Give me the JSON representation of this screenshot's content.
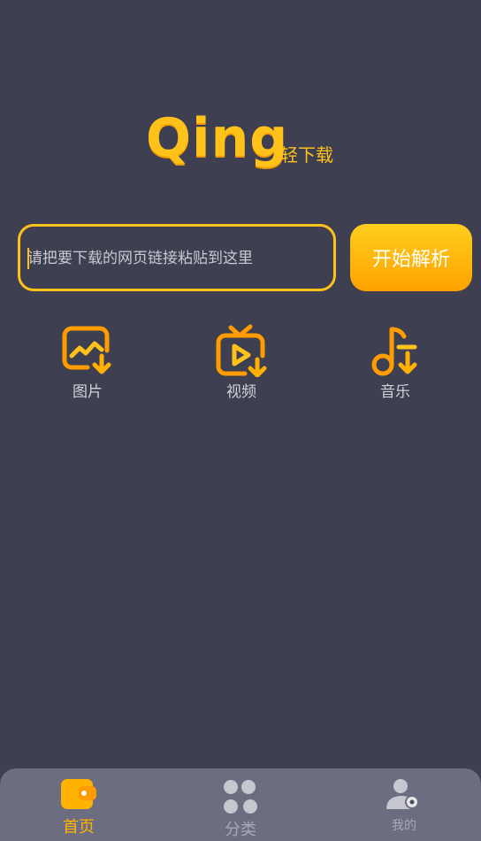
{
  "logo": {
    "word": "Qing",
    "subtitle": "轻下载"
  },
  "search": {
    "placeholder": "请把要下载的网页链接粘贴到这里",
    "value": ""
  },
  "parse_button": {
    "label": "开始解析"
  },
  "categories": [
    {
      "label": "图片",
      "icon": "image-download-icon"
    },
    {
      "label": "视频",
      "icon": "tv-download-icon"
    },
    {
      "label": "音乐",
      "icon": "music-download-icon"
    }
  ],
  "tabbar": {
    "items": [
      {
        "label": "首页",
        "icon": "wallet-home-icon",
        "active": true
      },
      {
        "label": "分类",
        "icon": "grid-icon",
        "active": false
      },
      {
        "label": "我的",
        "icon": "user-icon",
        "active": false
      }
    ]
  },
  "colors": {
    "accent": "#ffc21a",
    "accent_dark": "#ffa200",
    "background": "#3e3f51",
    "tabbar": "#6c6d80"
  }
}
